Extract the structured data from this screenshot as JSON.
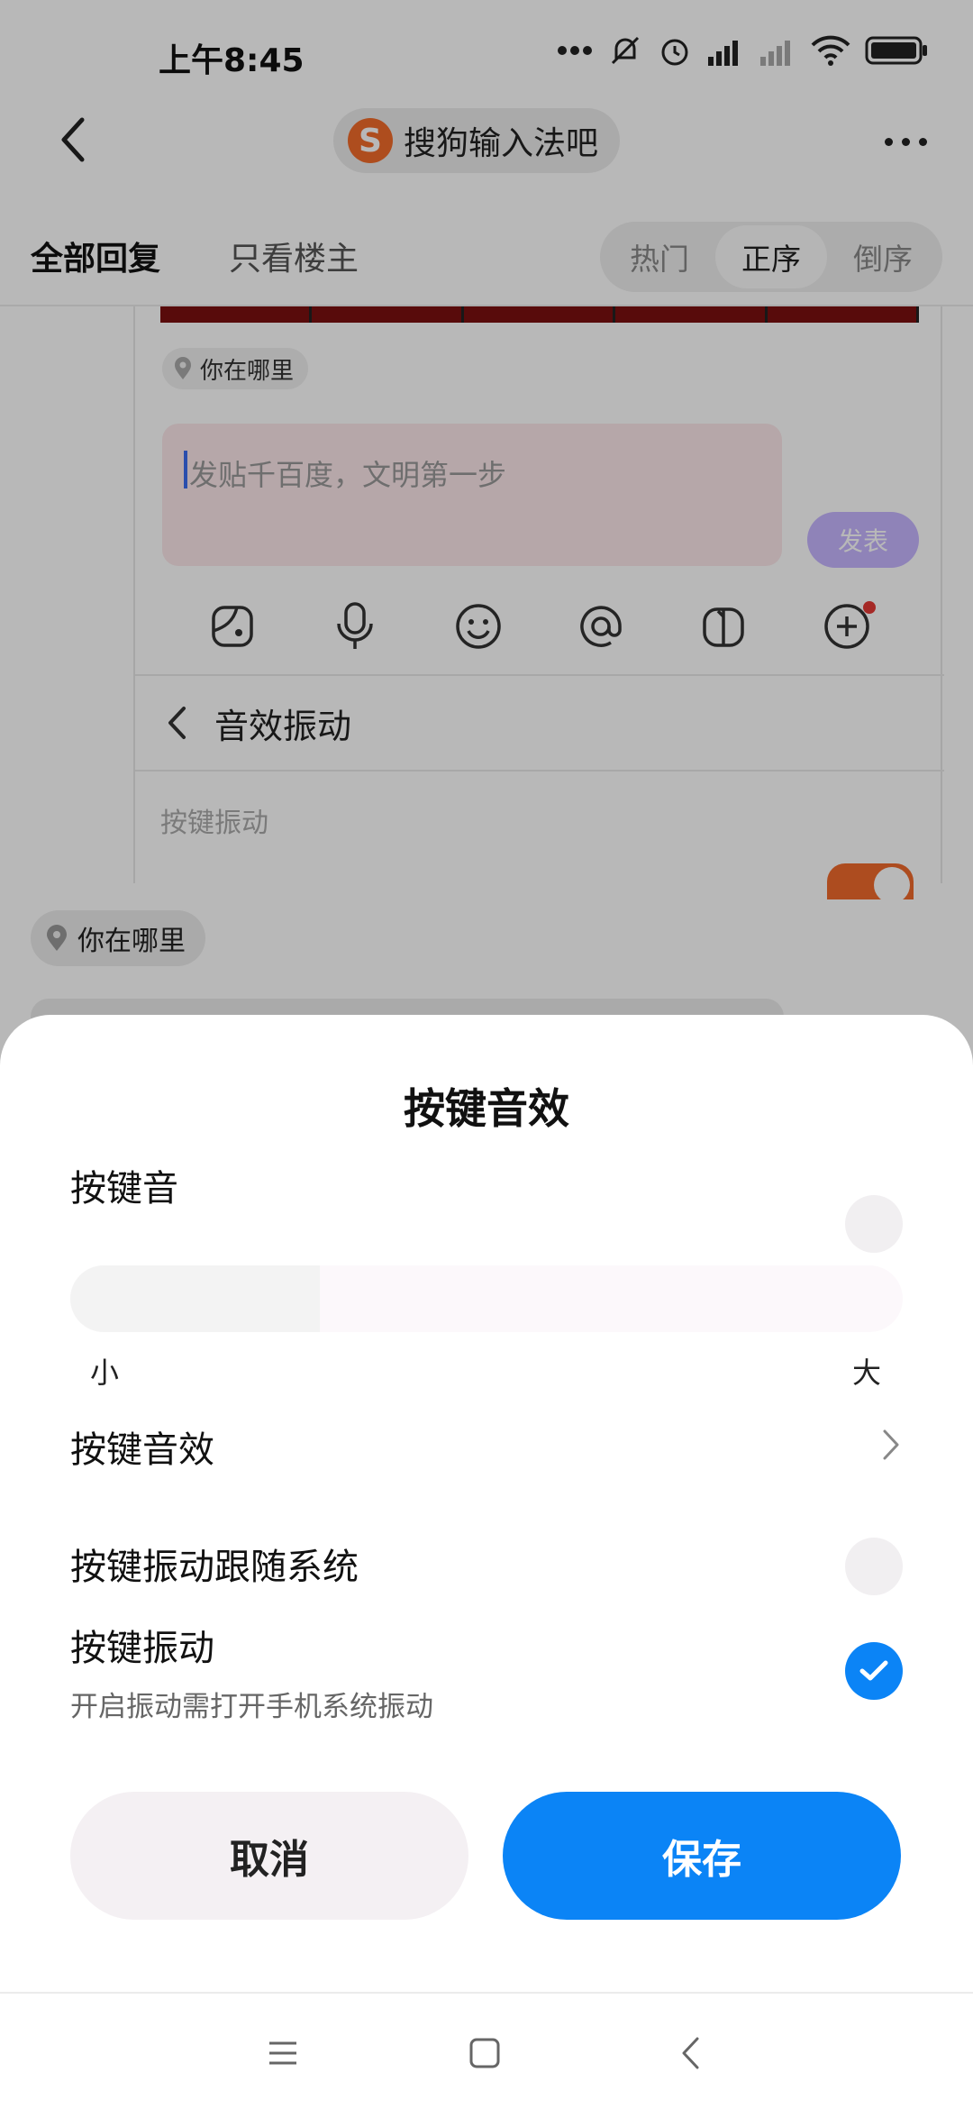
{
  "status_bar": {
    "time": "上午8:45"
  },
  "header": {
    "forum_logo_letter": "S",
    "forum_name": "搜狗输入法吧"
  },
  "tabs": {
    "all_replies": "全部回复",
    "owner_only": "只看楼主"
  },
  "sort_options": [
    "热门",
    "正序",
    "倒序"
  ],
  "sort_selected": "正序",
  "post_card": {
    "location_chip": "你在哪里",
    "reply_placeholder": "发贴千百度，文明第一步",
    "publish_label": "发表",
    "sound_panel_title": "音效振动",
    "key_vibration_label": "按键振动"
  },
  "page_location_chip": "你在哪里",
  "sheet": {
    "title": "按键音效",
    "key_sound": {
      "label": "按键音",
      "enabled": false
    },
    "volume": {
      "min_label": "小",
      "max_label": "大",
      "level": 0.3
    },
    "key_sound_effect": {
      "label": "按键音效"
    },
    "vibration_follow_system": {
      "label": "按键振动跟随系统",
      "enabled": false
    },
    "key_vibration": {
      "label": "按键振动",
      "sublabel": "开启振动需打开手机系统振动",
      "enabled": true
    },
    "cancel_label": "取消",
    "save_label": "保存"
  },
  "colors": {
    "accent_blue": "#0b84f6",
    "publish_purple": "#c6b6ff",
    "brand_orange": "#f26b2a",
    "notification_red": "#e53935"
  },
  "icons": [
    "back-arrow-icon",
    "more-dots-icon",
    "location-pin-icon",
    "sticker-icon",
    "microphone-icon",
    "emoji-icon",
    "at-sign-icon",
    "gift-icon",
    "add-circle-icon",
    "chevron-left-icon",
    "chevron-right-icon",
    "check-icon",
    "menu-icon",
    "home-square-icon",
    "back-triangle-icon"
  ]
}
